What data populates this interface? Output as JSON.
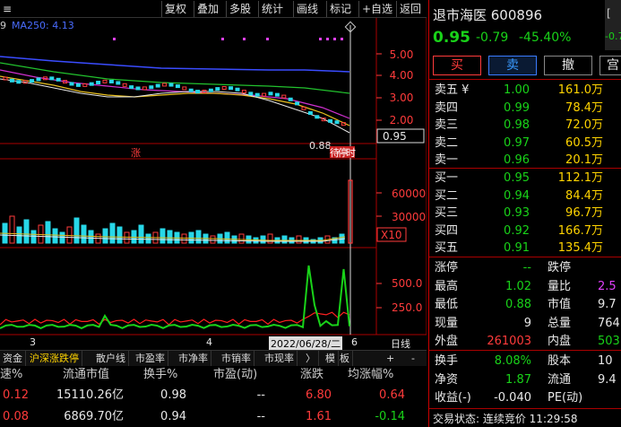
{
  "toolbar": {
    "buttons": [
      "复权",
      "叠加",
      "多股",
      "统计",
      "画线",
      "标记",
      "+自选",
      "返回"
    ]
  },
  "ma_row": {
    "prefix": "9",
    "ma250_label": "MA250: 4.13"
  },
  "price_axis": [
    "5.00",
    "4.00",
    "3.00",
    "2.00"
  ],
  "current_price_tag": "0.95",
  "low_label": "0.88",
  "zhang_label": "涨",
  "event_labels": [
    "待",
    "停",
    "时"
  ],
  "volume_axis": [
    "60000",
    "30000"
  ],
  "volume_unit": "X10",
  "indicator_axis": [
    "500.0",
    "250.0"
  ],
  "date_axis": {
    "m3": "3",
    "m4": "4",
    "cursor_date": "2022/06/28/二",
    "m6": "6",
    "period": "日线"
  },
  "tabs": [
    "资金",
    "沪深涨跌停",
    "散户线",
    "市盈率",
    "市净率",
    "市销率",
    "市现率",
    "〉",
    "模",
    "板",
    "+",
    "-"
  ],
  "table": {
    "headers": [
      "速%",
      "流通市值",
      "换手%",
      "市盈(动)",
      "涨跌",
      "均涨幅%"
    ],
    "rows": [
      [
        "0.12",
        "15110.26亿",
        "0.98",
        "--",
        "6.80",
        "0.64"
      ],
      [
        "0.08",
        "6869.70亿",
        "0.94",
        "--",
        "1.61",
        "-0.14"
      ]
    ]
  },
  "quote": {
    "name_code": "退市海医 600896",
    "price": "0.95",
    "change": "-0.79",
    "change_pct": "-45.40%",
    "edge_change": "-0.7",
    "buy_label": "买",
    "sell_label": "卖",
    "cancel_label": "撤",
    "more_label": "宫"
  },
  "asks": [
    {
      "label": "卖五 ¥",
      "price": "1.00",
      "vol": "161.0万"
    },
    {
      "label": "卖四",
      "price": "0.99",
      "vol": "78.4万"
    },
    {
      "label": "卖三",
      "price": "0.98",
      "vol": "72.0万"
    },
    {
      "label": "卖二",
      "price": "0.97",
      "vol": "60.5万"
    },
    {
      "label": "卖一",
      "price": "0.96",
      "vol": "20.1万"
    }
  ],
  "bids": [
    {
      "label": "买一",
      "price": "0.95",
      "vol": "112.1万"
    },
    {
      "label": "买二",
      "price": "0.94",
      "vol": "84.4万"
    },
    {
      "label": "买三",
      "price": "0.93",
      "vol": "96.7万"
    },
    {
      "label": "买四",
      "price": "0.92",
      "vol": "166.7万"
    },
    {
      "label": "买五",
      "price": "0.91",
      "vol": "135.4万"
    }
  ],
  "stats": [
    {
      "l1": "涨停",
      "v1": "--",
      "l2": "跌停",
      "v2": ""
    },
    {
      "l1": "最高",
      "v1": "1.02",
      "l2": "量比",
      "v2": "2.5"
    },
    {
      "l1": "最低",
      "v1": "0.88",
      "l2": "市值",
      "v2": "9.7"
    },
    {
      "l1": "现量",
      "v1": "9",
      "l2": "总量",
      "v2": "764"
    },
    {
      "l1": "外盘",
      "v1": "261003",
      "l2": "内盘",
      "v2": "503"
    }
  ],
  "stats2": [
    {
      "l1": "换手",
      "v1": "8.08%",
      "l2": "股本",
      "v2": "10"
    },
    {
      "l1": "净资",
      "v1": "1.87",
      "l2": "流通",
      "v2": "9.4"
    },
    {
      "l1": "收益(-)",
      "v1": "-0.040",
      "l2": "PE(动)",
      "v2": ""
    }
  ],
  "status_bar": "交易状态: 连续竞价 11:29:58"
}
